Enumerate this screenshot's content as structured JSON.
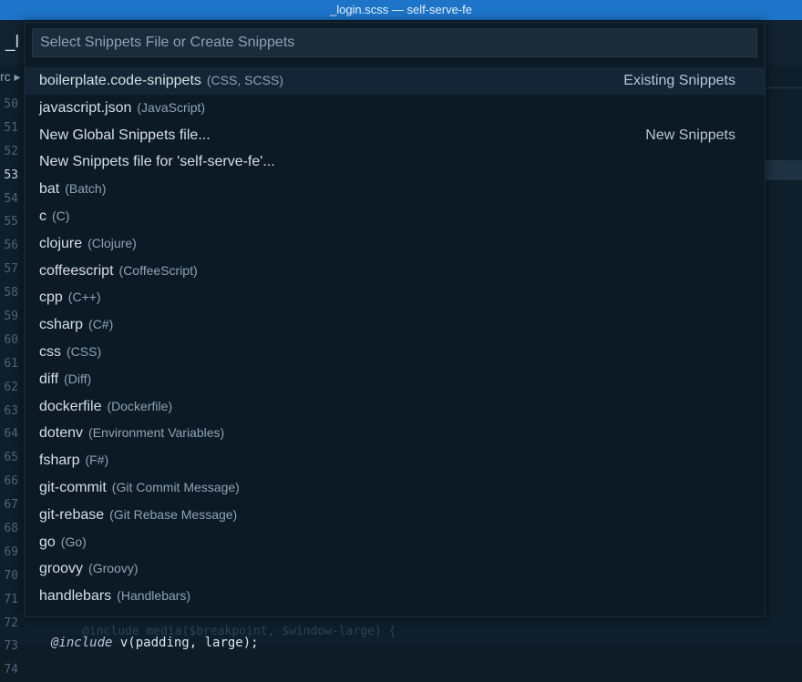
{
  "window": {
    "title": "_login.scss — self-serve-fe"
  },
  "editor": {
    "tab_fragment": "_l",
    "breadcrumb_fragment": "rc ▸",
    "line_numbers": [
      "50",
      "51",
      "52",
      "53",
      "54",
      "55",
      "56",
      "57",
      "58",
      "59",
      "60",
      "61",
      "62",
      "63",
      "64",
      "65",
      "66",
      "67",
      "68",
      "69",
      "70",
      "71",
      "72",
      "73",
      "74"
    ],
    "current_line": "53",
    "faded_code": "@include media($breakpoint, $window-large) {",
    "code_keyword": "@include",
    "code_rest": " v(padding, large);"
  },
  "quick_pick": {
    "placeholder": "Select Snippets File or Create Snippets",
    "value": "",
    "items": [
      {
        "label": "boilerplate.code-snippets",
        "description": "(CSS, SCSS)",
        "group": "Existing Snippets",
        "selected": true
      },
      {
        "label": "javascript.json",
        "description": "(JavaScript)",
        "group": ""
      },
      {
        "label": "New Global Snippets file...",
        "description": "",
        "group": "New Snippets"
      },
      {
        "label": "New Snippets file for 'self-serve-fe'...",
        "description": "",
        "group": ""
      },
      {
        "label": "bat",
        "description": "(Batch)",
        "group": ""
      },
      {
        "label": "c",
        "description": "(C)",
        "group": ""
      },
      {
        "label": "clojure",
        "description": "(Clojure)",
        "group": ""
      },
      {
        "label": "coffeescript",
        "description": "(CoffeeScript)",
        "group": ""
      },
      {
        "label": "cpp",
        "description": "(C++)",
        "group": ""
      },
      {
        "label": "csharp",
        "description": "(C#)",
        "group": ""
      },
      {
        "label": "css",
        "description": "(CSS)",
        "group": ""
      },
      {
        "label": "diff",
        "description": "(Diff)",
        "group": ""
      },
      {
        "label": "dockerfile",
        "description": "(Dockerfile)",
        "group": ""
      },
      {
        "label": "dotenv",
        "description": "(Environment Variables)",
        "group": ""
      },
      {
        "label": "fsharp",
        "description": "(F#)",
        "group": ""
      },
      {
        "label": "git-commit",
        "description": "(Git Commit Message)",
        "group": ""
      },
      {
        "label": "git-rebase",
        "description": "(Git Rebase Message)",
        "group": ""
      },
      {
        "label": "go",
        "description": "(Go)",
        "group": ""
      },
      {
        "label": "groovy",
        "description": "(Groovy)",
        "group": ""
      },
      {
        "label": "handlebars",
        "description": "(Handlebars)",
        "group": ""
      }
    ]
  },
  "colors": {
    "titlebar": "#1d74c9",
    "palette_bg": "#0c1a26",
    "selected_row": "#142636"
  }
}
